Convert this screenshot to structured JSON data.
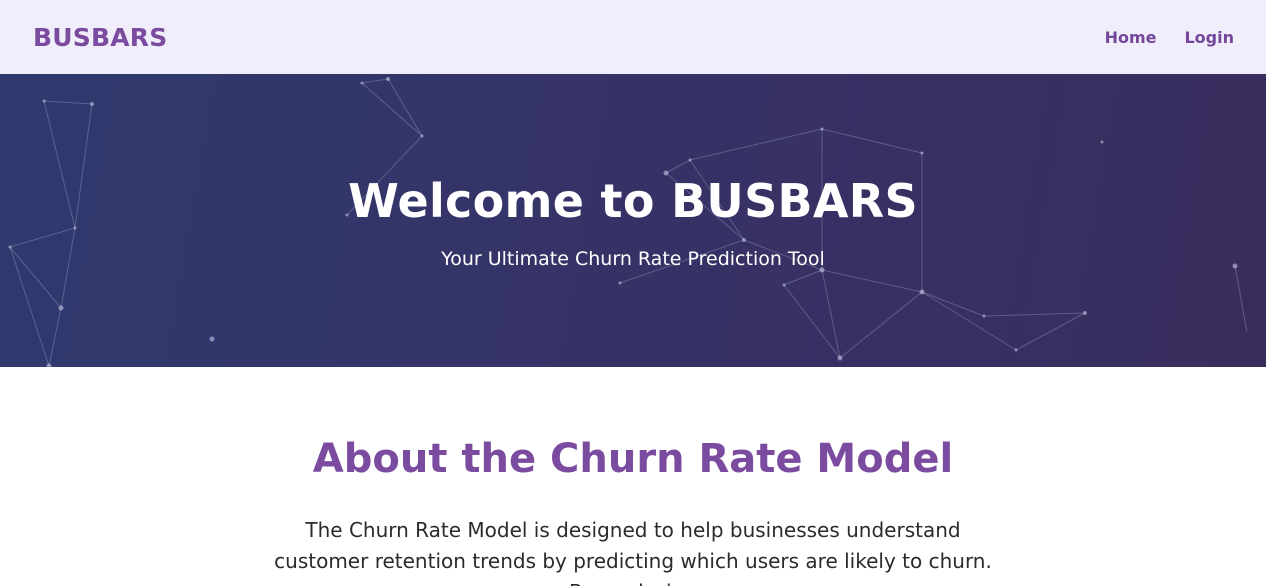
{
  "navbar": {
    "brand": "BUSBARS",
    "links": [
      {
        "label": "Home"
      },
      {
        "label": "Login"
      }
    ]
  },
  "hero": {
    "title": "Welcome to BUSBARS",
    "subtitle": "Your Ultimate Churn Rate Prediction Tool"
  },
  "about": {
    "title": "About the Churn Rate Model",
    "paragraph": "The Churn Rate Model is designed to help businesses understand customer retention trends by predicting which users are likely to churn. By analyzing"
  },
  "colors": {
    "accent": "#7b4ba0",
    "hero_gradient_start": "#2f3a6e",
    "hero_gradient_end": "#3a2d5e",
    "navbar_bg": "#f0eefa"
  }
}
